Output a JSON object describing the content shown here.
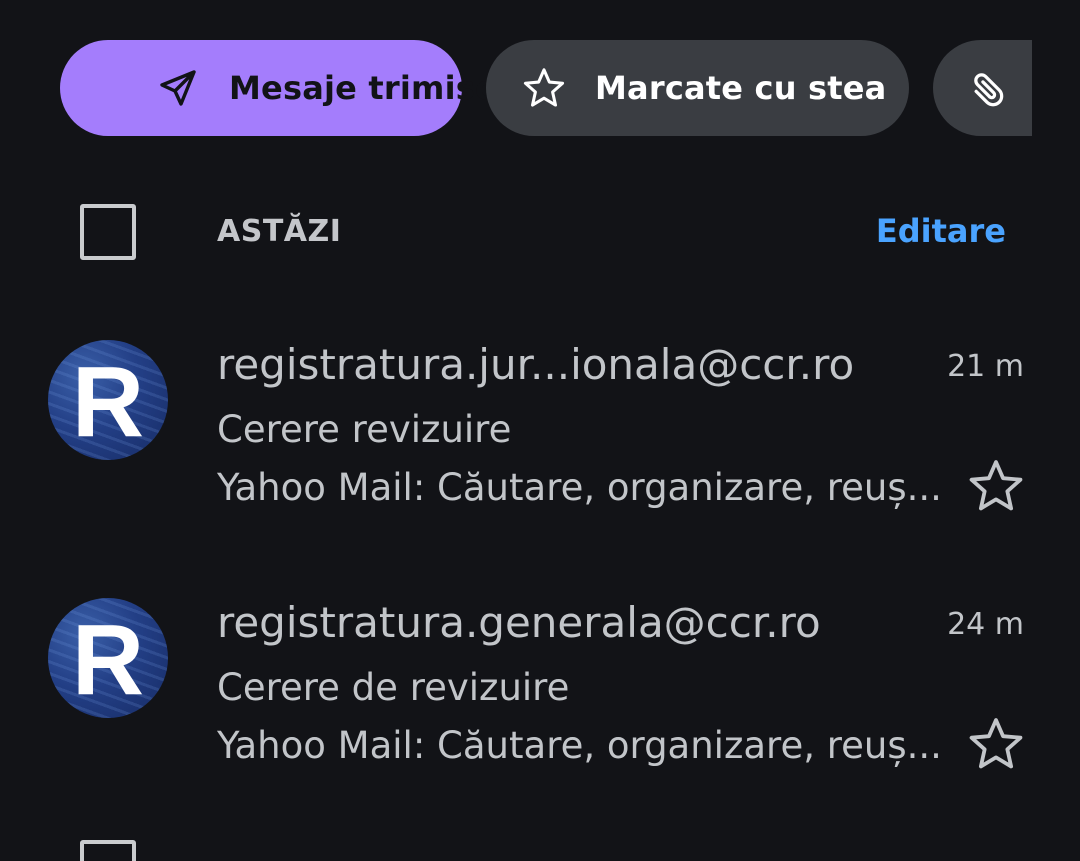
{
  "filters": {
    "sent": {
      "label": "Mesaje trimise",
      "icon": "send-icon",
      "color": "#a47dfc"
    },
    "starred": {
      "label": "Marcate cu stea",
      "icon": "star-icon"
    },
    "attachments": {
      "icon": "paperclip-icon"
    }
  },
  "section": {
    "title": "ASTĂZI",
    "edit_label": "Editare",
    "edit_color": "#4aa3ff"
  },
  "messages": [
    {
      "avatar_letter": "R",
      "sender": "registratura.jur...ionala@ccr.ro",
      "time": "21 m",
      "subject": "Cerere revizuire",
      "preview": "Yahoo Mail: Căutare, organizare, reuș...",
      "starred": false
    },
    {
      "avatar_letter": "R",
      "sender": "registratura.generala@ccr.ro",
      "time": "24 m",
      "subject": "Cerere de revizuire",
      "preview": "Yahoo Mail: Căutare, organizare, reuș...",
      "starred": false
    }
  ],
  "colors": {
    "background": "#121317",
    "chip_inactive": "#3a3d42",
    "text": "#c2c5c9"
  }
}
